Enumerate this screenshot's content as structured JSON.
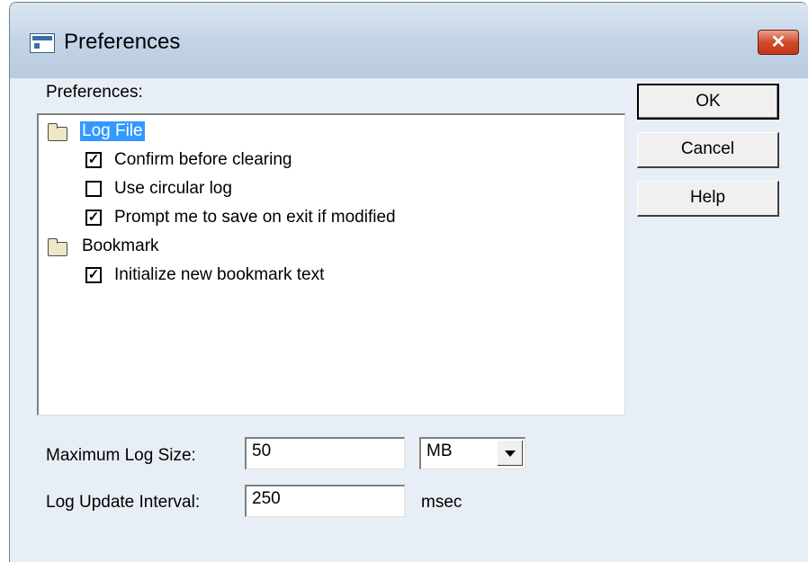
{
  "window": {
    "title": "Preferences",
    "close_glyph": "✕",
    "icon": "window-icon"
  },
  "tree": {
    "label": "Preferences:",
    "groups": [
      {
        "label": "Log File",
        "selected": true,
        "items": [
          {
            "label": "Confirm before clearing",
            "checked": true
          },
          {
            "label": "Use circular log",
            "checked": false
          },
          {
            "label": "Prompt me to save on exit if modified",
            "checked": true
          }
        ]
      },
      {
        "label": "Bookmark",
        "selected": false,
        "items": [
          {
            "label": "Initialize new bookmark text",
            "checked": true
          }
        ]
      }
    ]
  },
  "buttons": {
    "ok": "OK",
    "cancel": "Cancel",
    "help": "Help"
  },
  "fields": {
    "max_log_size_label": "Maximum Log Size:",
    "max_log_size_value": "50",
    "max_log_size_unit": "MB",
    "log_update_label": "Log Update Interval:",
    "log_update_value": "250",
    "log_update_unit": "msec"
  },
  "check_glyph": "✓",
  "colors": {
    "selection": "#3399ff",
    "close_button": "#c1351a"
  }
}
